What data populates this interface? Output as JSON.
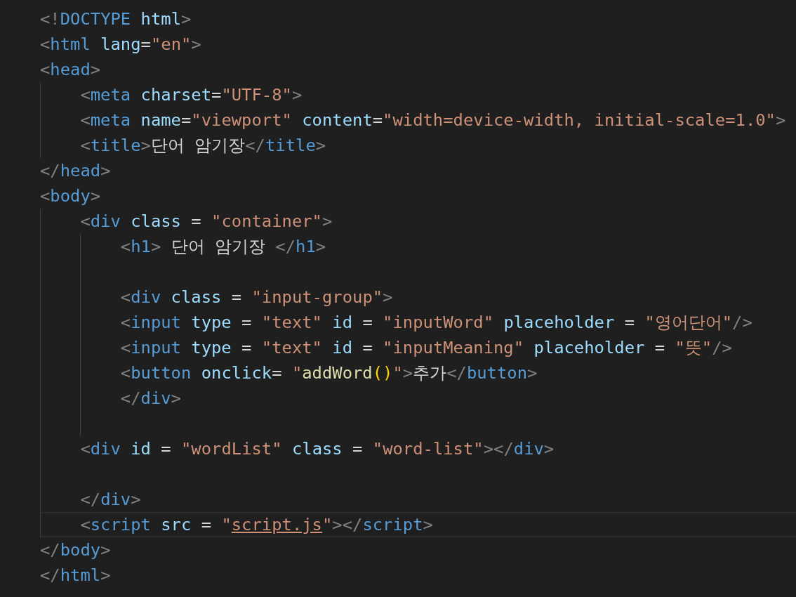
{
  "editor": {
    "lines": [
      {
        "current": false,
        "tokens": [
          {
            "kind": "punct",
            "text": "<!"
          },
          {
            "kind": "tag",
            "text": "DOCTYPE"
          },
          {
            "kind": "attr",
            "text": " html"
          },
          {
            "kind": "punct",
            "text": ">"
          }
        ]
      },
      {
        "current": false,
        "tokens": [
          {
            "kind": "punct",
            "text": "<"
          },
          {
            "kind": "tag",
            "text": "html"
          },
          {
            "kind": "attr",
            "text": " lang"
          },
          {
            "kind": "text",
            "text": "="
          },
          {
            "kind": "str",
            "text": "\"en\""
          },
          {
            "kind": "punct",
            "text": ">"
          }
        ]
      },
      {
        "current": false,
        "tokens": [
          {
            "kind": "punct",
            "text": "<"
          },
          {
            "kind": "tag",
            "text": "head"
          },
          {
            "kind": "punct",
            "text": ">"
          }
        ],
        "children": [
          {
            "current": false,
            "tokens": [
              {
                "kind": "punct",
                "text": "<"
              },
              {
                "kind": "tag",
                "text": "meta"
              },
              {
                "kind": "attr",
                "text": " charset"
              },
              {
                "kind": "text",
                "text": "="
              },
              {
                "kind": "str",
                "text": "\"UTF-8\""
              },
              {
                "kind": "punct",
                "text": ">"
              }
            ]
          },
          {
            "current": false,
            "tokens": [
              {
                "kind": "punct",
                "text": "<"
              },
              {
                "kind": "tag",
                "text": "meta"
              },
              {
                "kind": "attr",
                "text": " name"
              },
              {
                "kind": "text",
                "text": "="
              },
              {
                "kind": "str",
                "text": "\"viewport\""
              },
              {
                "kind": "attr",
                "text": " content"
              },
              {
                "kind": "text",
                "text": "="
              },
              {
                "kind": "str",
                "text": "\"width=device-width, initial-scale=1.0\""
              },
              {
                "kind": "punct",
                "text": ">"
              }
            ]
          },
          {
            "current": false,
            "tokens": [
              {
                "kind": "punct",
                "text": "<"
              },
              {
                "kind": "tag",
                "text": "title"
              },
              {
                "kind": "punct",
                "text": ">"
              },
              {
                "kind": "text",
                "text": "단어 암기장"
              },
              {
                "kind": "punct",
                "text": "</"
              },
              {
                "kind": "tag",
                "text": "title"
              },
              {
                "kind": "punct",
                "text": ">"
              }
            ]
          }
        ]
      },
      {
        "current": false,
        "tokens": [
          {
            "kind": "punct",
            "text": "</"
          },
          {
            "kind": "tag",
            "text": "head"
          },
          {
            "kind": "punct",
            "text": ">"
          }
        ]
      },
      {
        "current": false,
        "tokens": [
          {
            "kind": "punct",
            "text": "<"
          },
          {
            "kind": "tag",
            "text": "body"
          },
          {
            "kind": "punct",
            "text": ">"
          }
        ],
        "children": [
          {
            "current": false,
            "tokens": [
              {
                "kind": "punct",
                "text": "<"
              },
              {
                "kind": "tag",
                "text": "div"
              },
              {
                "kind": "attr",
                "text": " class"
              },
              {
                "kind": "text",
                "text": " = "
              },
              {
                "kind": "str",
                "text": "\"container\""
              },
              {
                "kind": "punct",
                "text": ">"
              }
            ],
            "children": [
              {
                "current": false,
                "tokens": [
                  {
                    "kind": "punct",
                    "text": "<"
                  },
                  {
                    "kind": "tag",
                    "text": "h1"
                  },
                  {
                    "kind": "punct",
                    "text": ">"
                  },
                  {
                    "kind": "text",
                    "text": " 단어 암기장 "
                  },
                  {
                    "kind": "punct",
                    "text": "</"
                  },
                  {
                    "kind": "tag",
                    "text": "h1"
                  },
                  {
                    "kind": "punct",
                    "text": ">"
                  }
                ]
              },
              {
                "current": false
              },
              {
                "current": false,
                "tokens": [
                  {
                    "kind": "punct",
                    "text": "<"
                  },
                  {
                    "kind": "tag",
                    "text": "div"
                  },
                  {
                    "kind": "attr",
                    "text": " class"
                  },
                  {
                    "kind": "text",
                    "text": " = "
                  },
                  {
                    "kind": "str",
                    "text": "\"input-group\""
                  },
                  {
                    "kind": "punct",
                    "text": ">"
                  }
                ]
              },
              {
                "current": false,
                "tokens": [
                  {
                    "kind": "punct",
                    "text": "<"
                  },
                  {
                    "kind": "tag",
                    "text": "input"
                  },
                  {
                    "kind": "attr",
                    "text": " type"
                  },
                  {
                    "kind": "text",
                    "text": " = "
                  },
                  {
                    "kind": "str",
                    "text": "\"text\""
                  },
                  {
                    "kind": "attr",
                    "text": " id"
                  },
                  {
                    "kind": "text",
                    "text": " = "
                  },
                  {
                    "kind": "str",
                    "text": "\"inputWord\""
                  },
                  {
                    "kind": "attr",
                    "text": " placeholder"
                  },
                  {
                    "kind": "text",
                    "text": " = "
                  },
                  {
                    "kind": "str",
                    "text": "\"영어단어\""
                  },
                  {
                    "kind": "punct",
                    "text": "/>"
                  }
                ]
              },
              {
                "current": false,
                "tokens": [
                  {
                    "kind": "punct",
                    "text": "<"
                  },
                  {
                    "kind": "tag",
                    "text": "input"
                  },
                  {
                    "kind": "attr",
                    "text": " type"
                  },
                  {
                    "kind": "text",
                    "text": " = "
                  },
                  {
                    "kind": "str",
                    "text": "\"text\""
                  },
                  {
                    "kind": "attr",
                    "text": " id"
                  },
                  {
                    "kind": "text",
                    "text": " = "
                  },
                  {
                    "kind": "str",
                    "text": "\"inputMeaning\""
                  },
                  {
                    "kind": "attr",
                    "text": " placeholder"
                  },
                  {
                    "kind": "text",
                    "text": " = "
                  },
                  {
                    "kind": "str",
                    "text": "\"뜻\""
                  },
                  {
                    "kind": "punct",
                    "text": "/>"
                  }
                ]
              },
              {
                "current": false,
                "tokens": [
                  {
                    "kind": "punct",
                    "text": "<"
                  },
                  {
                    "kind": "tag",
                    "text": "button"
                  },
                  {
                    "kind": "attr",
                    "text": " onclick"
                  },
                  {
                    "kind": "text",
                    "text": "= "
                  },
                  {
                    "kind": "str",
                    "text": "\""
                  },
                  {
                    "kind": "fn",
                    "text": "addWord"
                  },
                  {
                    "kind": "paren",
                    "text": "()"
                  },
                  {
                    "kind": "str",
                    "text": "\""
                  },
                  {
                    "kind": "punct",
                    "text": ">"
                  },
                  {
                    "kind": "text",
                    "text": "추가"
                  },
                  {
                    "kind": "punct",
                    "text": "</"
                  },
                  {
                    "kind": "tag",
                    "text": "button"
                  },
                  {
                    "kind": "punct",
                    "text": ">"
                  }
                ]
              },
              {
                "current": false,
                "tokens": [
                  {
                    "kind": "punct",
                    "text": "</"
                  },
                  {
                    "kind": "tag",
                    "text": "div"
                  },
                  {
                    "kind": "punct",
                    "text": ">"
                  }
                ]
              },
              {
                "current": false
              }
            ]
          },
          {
            "current": false,
            "tokens": [
              {
                "kind": "punct",
                "text": "<"
              },
              {
                "kind": "tag",
                "text": "div"
              },
              {
                "kind": "attr",
                "text": " id"
              },
              {
                "kind": "text",
                "text": " = "
              },
              {
                "kind": "str",
                "text": "\"wordList\""
              },
              {
                "kind": "attr",
                "text": " class"
              },
              {
                "kind": "text",
                "text": " = "
              },
              {
                "kind": "str",
                "text": "\"word-list\""
              },
              {
                "kind": "punct",
                "text": "></"
              },
              {
                "kind": "tag",
                "text": "div"
              },
              {
                "kind": "punct",
                "text": ">"
              }
            ]
          },
          {
            "current": false
          },
          {
            "current": false,
            "tokens": [
              {
                "kind": "punct",
                "text": "</"
              },
              {
                "kind": "tag",
                "text": "div"
              },
              {
                "kind": "punct",
                "text": ">"
              }
            ]
          },
          {
            "current": true,
            "tokens": [
              {
                "kind": "punct",
                "text": "<"
              },
              {
                "kind": "tag",
                "text": "script"
              },
              {
                "kind": "attr",
                "text": " src"
              },
              {
                "kind": "text",
                "text": " = "
              },
              {
                "kind": "str",
                "text": "\""
              },
              {
                "kind": "link",
                "text": "script.js"
              },
              {
                "kind": "str",
                "text": "\""
              },
              {
                "kind": "punct",
                "text": "></"
              },
              {
                "kind": "tag",
                "text": "script"
              },
              {
                "kind": "punct",
                "text": ">"
              }
            ]
          }
        ]
      },
      {
        "current": false,
        "tokens": [
          {
            "kind": "punct",
            "text": "</"
          },
          {
            "kind": "tag",
            "text": "body"
          },
          {
            "kind": "punct",
            "text": ">"
          }
        ]
      },
      {
        "current": false,
        "tokens": [
          {
            "kind": "punct",
            "text": "</"
          },
          {
            "kind": "tag",
            "text": "html"
          },
          {
            "kind": "punct",
            "text": ">"
          }
        ]
      }
    ]
  }
}
